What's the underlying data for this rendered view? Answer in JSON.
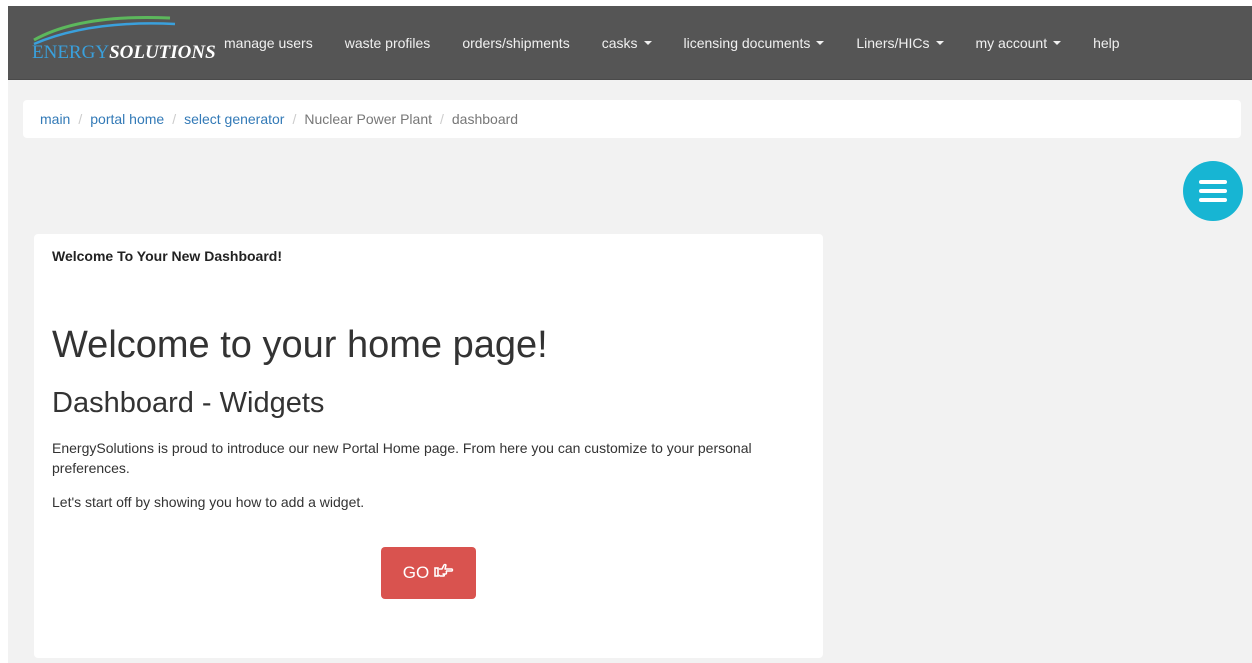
{
  "brand": {
    "part1": "ENERGY",
    "part2": "SOLUTIONS",
    "colors": {
      "swoosh_green": "#5cb85c",
      "swoosh_blue": "#3aa0dc",
      "text_blue": "#3aa0dc"
    }
  },
  "nav": {
    "items": [
      {
        "label": "manage users",
        "dropdown": false
      },
      {
        "label": "waste profiles",
        "dropdown": false
      },
      {
        "label": "orders/shipments",
        "dropdown": false
      },
      {
        "label": "casks",
        "dropdown": true
      },
      {
        "label": "licensing documents",
        "dropdown": true
      },
      {
        "label": "Liners/HICs",
        "dropdown": true
      },
      {
        "label": "my account",
        "dropdown": true
      },
      {
        "label": "help",
        "dropdown": false
      }
    ],
    "background": "#555555"
  },
  "breadcrumb": {
    "items": [
      {
        "label": "main",
        "link": true
      },
      {
        "label": "portal home",
        "link": true
      },
      {
        "label": "select generator",
        "link": true
      },
      {
        "label": "Nuclear Power Plant",
        "link": false
      },
      {
        "label": "dashboard",
        "link": false
      }
    ],
    "separator": "/"
  },
  "menu_button": {
    "icon": "hamburger-icon",
    "color": "#17b5d3"
  },
  "panel": {
    "heading": "Welcome To Your New Dashboard!",
    "title": "Welcome to your home page!",
    "subtitle": "Dashboard - Widgets",
    "paragraph1": "EnergySolutions is proud to introduce our new Portal Home page. From here you can customize to your personal preferences.",
    "paragraph2": "Let's start off by showing you how to add a widget.",
    "go_button": {
      "label": "GO",
      "icon": "hand-pointer-right-icon",
      "color": "#d9534f"
    }
  }
}
